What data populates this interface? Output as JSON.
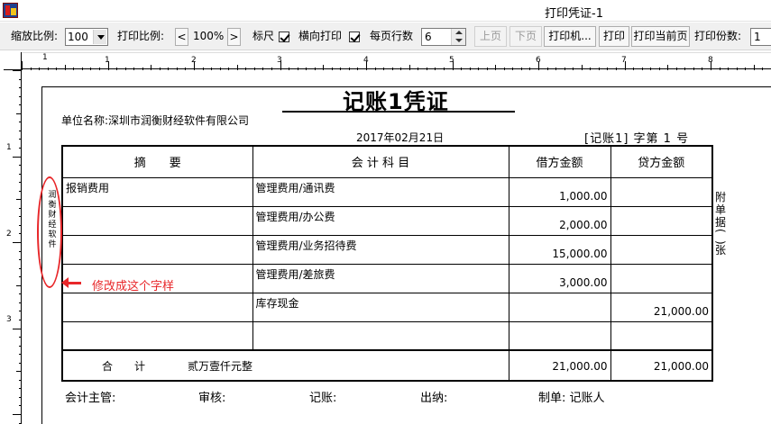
{
  "window": {
    "title": "打印凭证-1"
  },
  "toolbar": {
    "zoom_label": "缩放比例:",
    "zoom_value": "100",
    "print_scale_label": "打印比例:",
    "print_scale_prev": "<",
    "print_scale_value": "100%",
    "print_scale_next": ">",
    "ruler_label": "标尺",
    "ruler_checked": true,
    "landscape_label": "横向打印",
    "landscape_checked": true,
    "rows_per_page_label": "每页行数",
    "rows_per_page_value": "6",
    "prev_page": "上页",
    "next_page": "下页",
    "printer": "打印机...",
    "print": "打印",
    "print_current": "打印当前页",
    "copies_label": "打印份数:",
    "copies_value": "1"
  },
  "ruler": {
    "h_labels": [
      "1",
      "1",
      "2",
      "3",
      "4",
      "5",
      "6",
      "7",
      "8"
    ],
    "v_labels": [
      "1",
      "2",
      "3"
    ]
  },
  "voucher": {
    "title": "记账1凭证",
    "unit_label": "单位名称:",
    "unit_name": "深圳市润衡财经软件有限公司",
    "date": "2017年02月21日",
    "voucher_no": "[记账1] 字第 1 号",
    "headers": {
      "summary": "摘　　要",
      "account": "会 计 科 目",
      "debit": "借方金额",
      "credit": "贷方金额"
    },
    "rows": [
      {
        "summary": "报销费用",
        "account": "管理费用/通讯费",
        "debit": "1,000.00",
        "credit": ""
      },
      {
        "summary": "",
        "account": "管理费用/办公费",
        "debit": "2,000.00",
        "credit": ""
      },
      {
        "summary": "",
        "account": "管理费用/业务招待费",
        "debit": "15,000.00",
        "credit": ""
      },
      {
        "summary": "",
        "account": "管理费用/差旅费",
        "debit": "3,000.00",
        "credit": ""
      },
      {
        "summary": "",
        "account": "库存现金",
        "debit": "",
        "credit": "21,000.00"
      },
      {
        "summary": "",
        "account": "",
        "debit": "",
        "credit": ""
      }
    ],
    "total": {
      "label": "合　　计",
      "amount_words": "贰万壹仟元整",
      "debit": "21,000.00",
      "credit": "21,000.00"
    },
    "attachment": {
      "prefix": "附单据",
      "paren_open": "(",
      "paren_close": ")",
      "suffix": "张"
    },
    "footer": {
      "supervisor": "会计主管:",
      "reviewer": "审核:",
      "bookkeeper": "记账:",
      "cashier": "出纳:",
      "maker": "制单: 记账人"
    },
    "side_mark": "润衡财经软件"
  },
  "annotation": {
    "note": "修改成这个字样",
    "color": "#e8272a"
  }
}
